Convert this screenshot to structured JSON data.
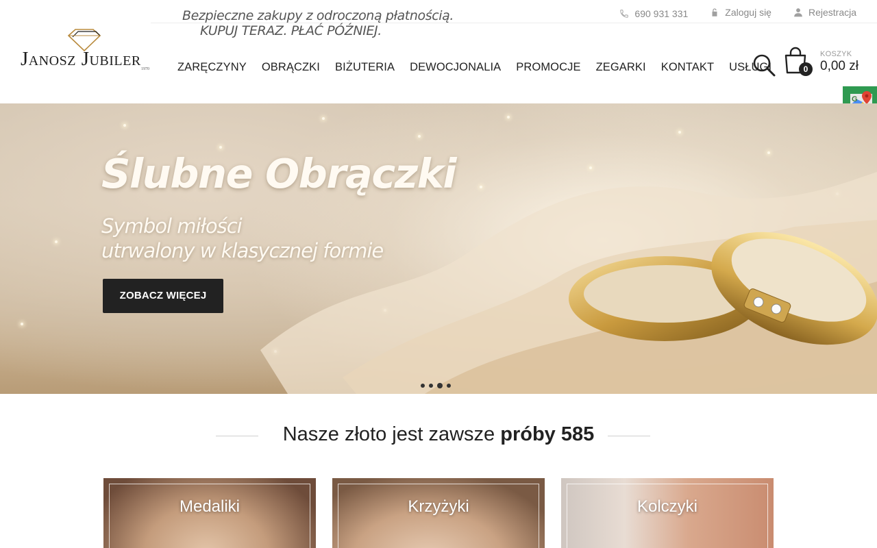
{
  "header": {
    "promo_line1": "Bezpieczne zakupy z odroczoną płatnością.",
    "promo_line2": "KUPUJ TERAZ. PŁAĆ PÓŹNIEJ.",
    "phone": "690 931 331",
    "login": "Zaloguj się",
    "register": "Rejestracja",
    "logo_name": "Janosz Jubiler",
    "logo_year": "1970",
    "cart_label": "KOSZYK",
    "cart_total": "0,00 zł",
    "cart_count": "0"
  },
  "nav": {
    "items": [
      "ZARĘCZYNY",
      "OBRĄCZKI",
      "BIŻUTERIA",
      "DEWOCJONALIA",
      "PROMOCJE",
      "ZEGARKI",
      "KONTAKT",
      "USŁUGI"
    ]
  },
  "hero": {
    "title": "Ślubne Obrączki",
    "subtitle_line1": "Symbol miłości",
    "subtitle_line2": "utrwalony w klasycznej formie",
    "button": "ZOBACZ WIĘCEJ",
    "slides": 4,
    "active_slide": 3
  },
  "section": {
    "title_regular": "Nasze złoto jest zawsze ",
    "title_bold": "próby 585"
  },
  "tiles": [
    "Medaliki",
    "Krzyżyki",
    "Kolczyki"
  ],
  "side_buttons": [
    "google-maps-icon",
    "google-maps-icon"
  ],
  "colors": {
    "accent_dark": "#222222",
    "maps_green": "#2f9a51",
    "text_muted": "#888888"
  }
}
